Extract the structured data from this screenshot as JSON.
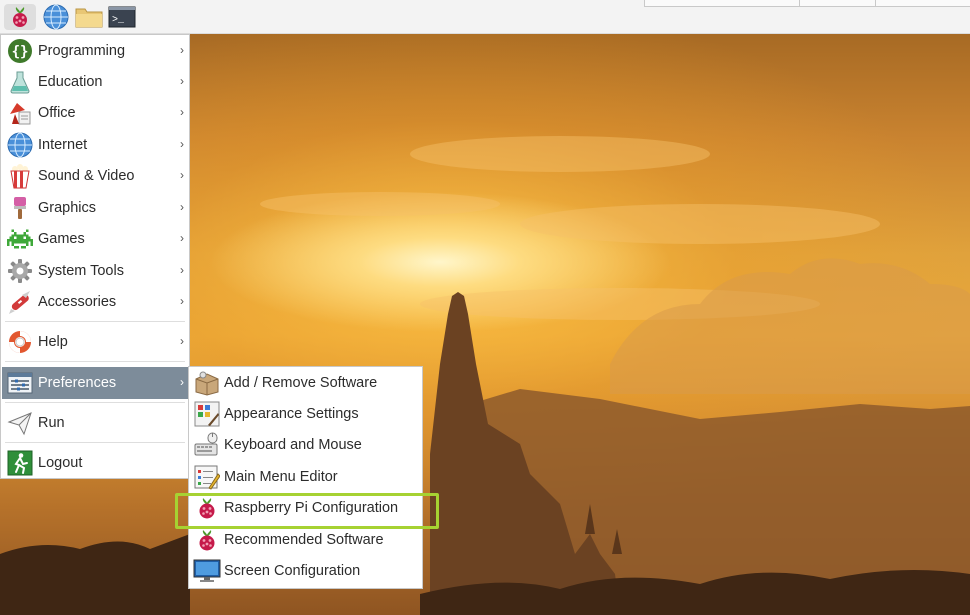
{
  "taskbar": {
    "menu_icon": "raspberry-icon",
    "web_icon": "globe-icon",
    "files_icon": "folder-icon",
    "terminal_icon": "terminal-icon",
    "terminal_prompt": ">_"
  },
  "main_menu": {
    "items": [
      {
        "label": "Programming",
        "icon": "programming-icon",
        "has_submenu": true
      },
      {
        "label": "Education",
        "icon": "flask-icon",
        "has_submenu": true
      },
      {
        "label": "Office",
        "icon": "office-icon",
        "has_submenu": true
      },
      {
        "label": "Internet",
        "icon": "globe-icon",
        "has_submenu": true
      },
      {
        "label": "Sound & Video",
        "icon": "popcorn-icon",
        "has_submenu": true
      },
      {
        "label": "Graphics",
        "icon": "paintbrush-icon",
        "has_submenu": true
      },
      {
        "label": "Games",
        "icon": "space-invader-icon",
        "has_submenu": true
      },
      {
        "label": "System Tools",
        "icon": "gear-icon",
        "has_submenu": true
      },
      {
        "label": "Accessories",
        "icon": "swiss-knife-icon",
        "has_submenu": true
      },
      {
        "label": "Help",
        "icon": "lifebuoy-icon",
        "has_submenu": true
      },
      {
        "label": "Preferences",
        "icon": "preferences-icon",
        "has_submenu": true,
        "active": true
      },
      {
        "label": "Run",
        "icon": "paper-plane-icon",
        "has_submenu": false
      },
      {
        "label": "Logout",
        "icon": "exit-icon",
        "has_submenu": false
      }
    ],
    "arrow_glyph": "›"
  },
  "preferences_submenu": {
    "items": [
      {
        "label": "Add / Remove Software",
        "icon": "package-icon"
      },
      {
        "label": "Appearance Settings",
        "icon": "appearance-icon"
      },
      {
        "label": "Keyboard and Mouse",
        "icon": "keyboard-mouse-icon"
      },
      {
        "label": "Main Menu Editor",
        "icon": "menu-editor-icon"
      },
      {
        "label": "Raspberry Pi Configuration",
        "icon": "raspberry-icon",
        "highlighted": true
      },
      {
        "label": "Recommended Software",
        "icon": "raspberry-icon"
      },
      {
        "label": "Screen Configuration",
        "icon": "monitor-icon"
      }
    ]
  },
  "colors": {
    "menu_active_bg": "#7d8c9a",
    "highlight_border": "#a6d232",
    "raspberry_red": "#c51a4a",
    "raspberry_leaf": "#4c9a2a"
  }
}
